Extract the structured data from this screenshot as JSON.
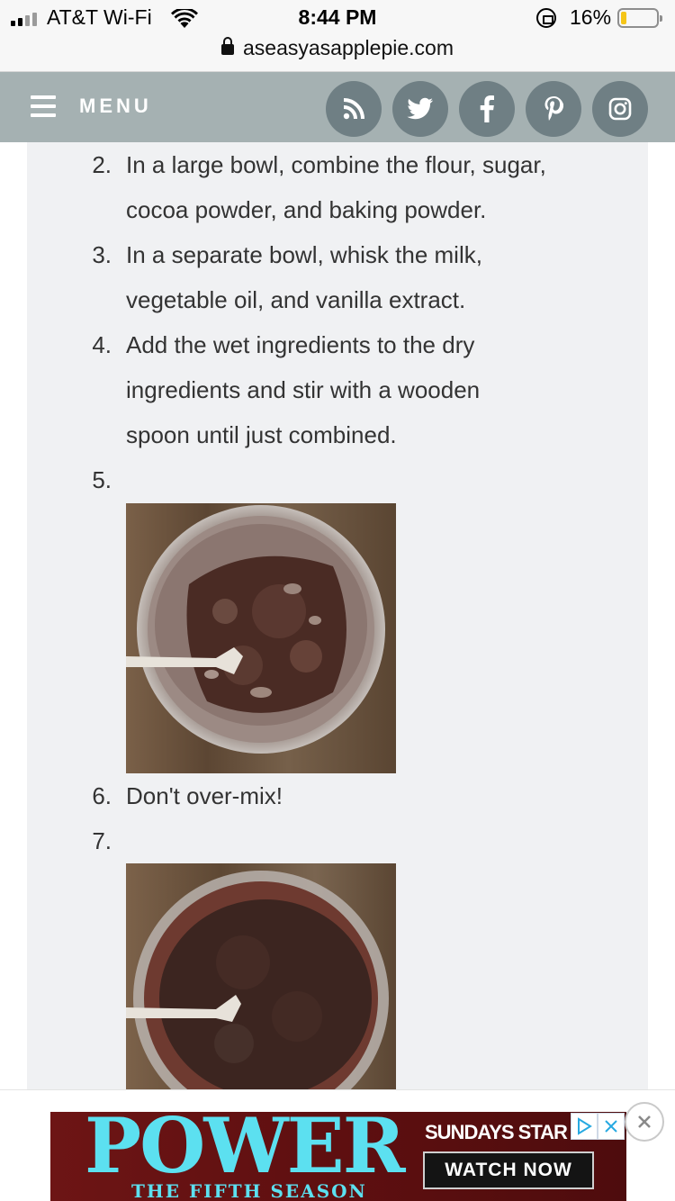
{
  "status_bar": {
    "carrier": "AT&T Wi-Fi",
    "time": "8:44 PM",
    "battery_percent": "16%",
    "battery_level": 0.16,
    "url": "aseasyasapplepie.com"
  },
  "header": {
    "menu_label": "MENU",
    "social_icons": [
      "rss-icon",
      "twitter-icon",
      "facebook-icon",
      "pinterest-icon",
      "instagram-icon"
    ],
    "bg_color": "#a5b1b2",
    "icon_bg_color": "#6f7f84"
  },
  "steps": [
    {
      "number": "2.",
      "lines": [
        "In a large bowl, combine the flour, sugar,",
        "cocoa powder, and baking powder."
      ]
    },
    {
      "number": "3.",
      "lines": [
        "In a separate bowl, whisk the milk,",
        "vegetable oil, and vanilla extract."
      ]
    },
    {
      "number": "4.",
      "lines": [
        "Add the wet ingredients to the dry",
        "ingredients and stir with a wooden",
        "spoon until just combined."
      ]
    },
    {
      "number": "5.",
      "image": "batter-partially-mixed-photo"
    },
    {
      "number": "6.",
      "lines": [
        "Don't over-mix!"
      ]
    },
    {
      "number": "7.",
      "image": "batter-mixed-photo"
    }
  ],
  "ad": {
    "title": "POWER",
    "subtitle": "THE FIFTH SEASON",
    "tagline": "SUNDAYS STAR",
    "cta": "WATCH NOW"
  }
}
